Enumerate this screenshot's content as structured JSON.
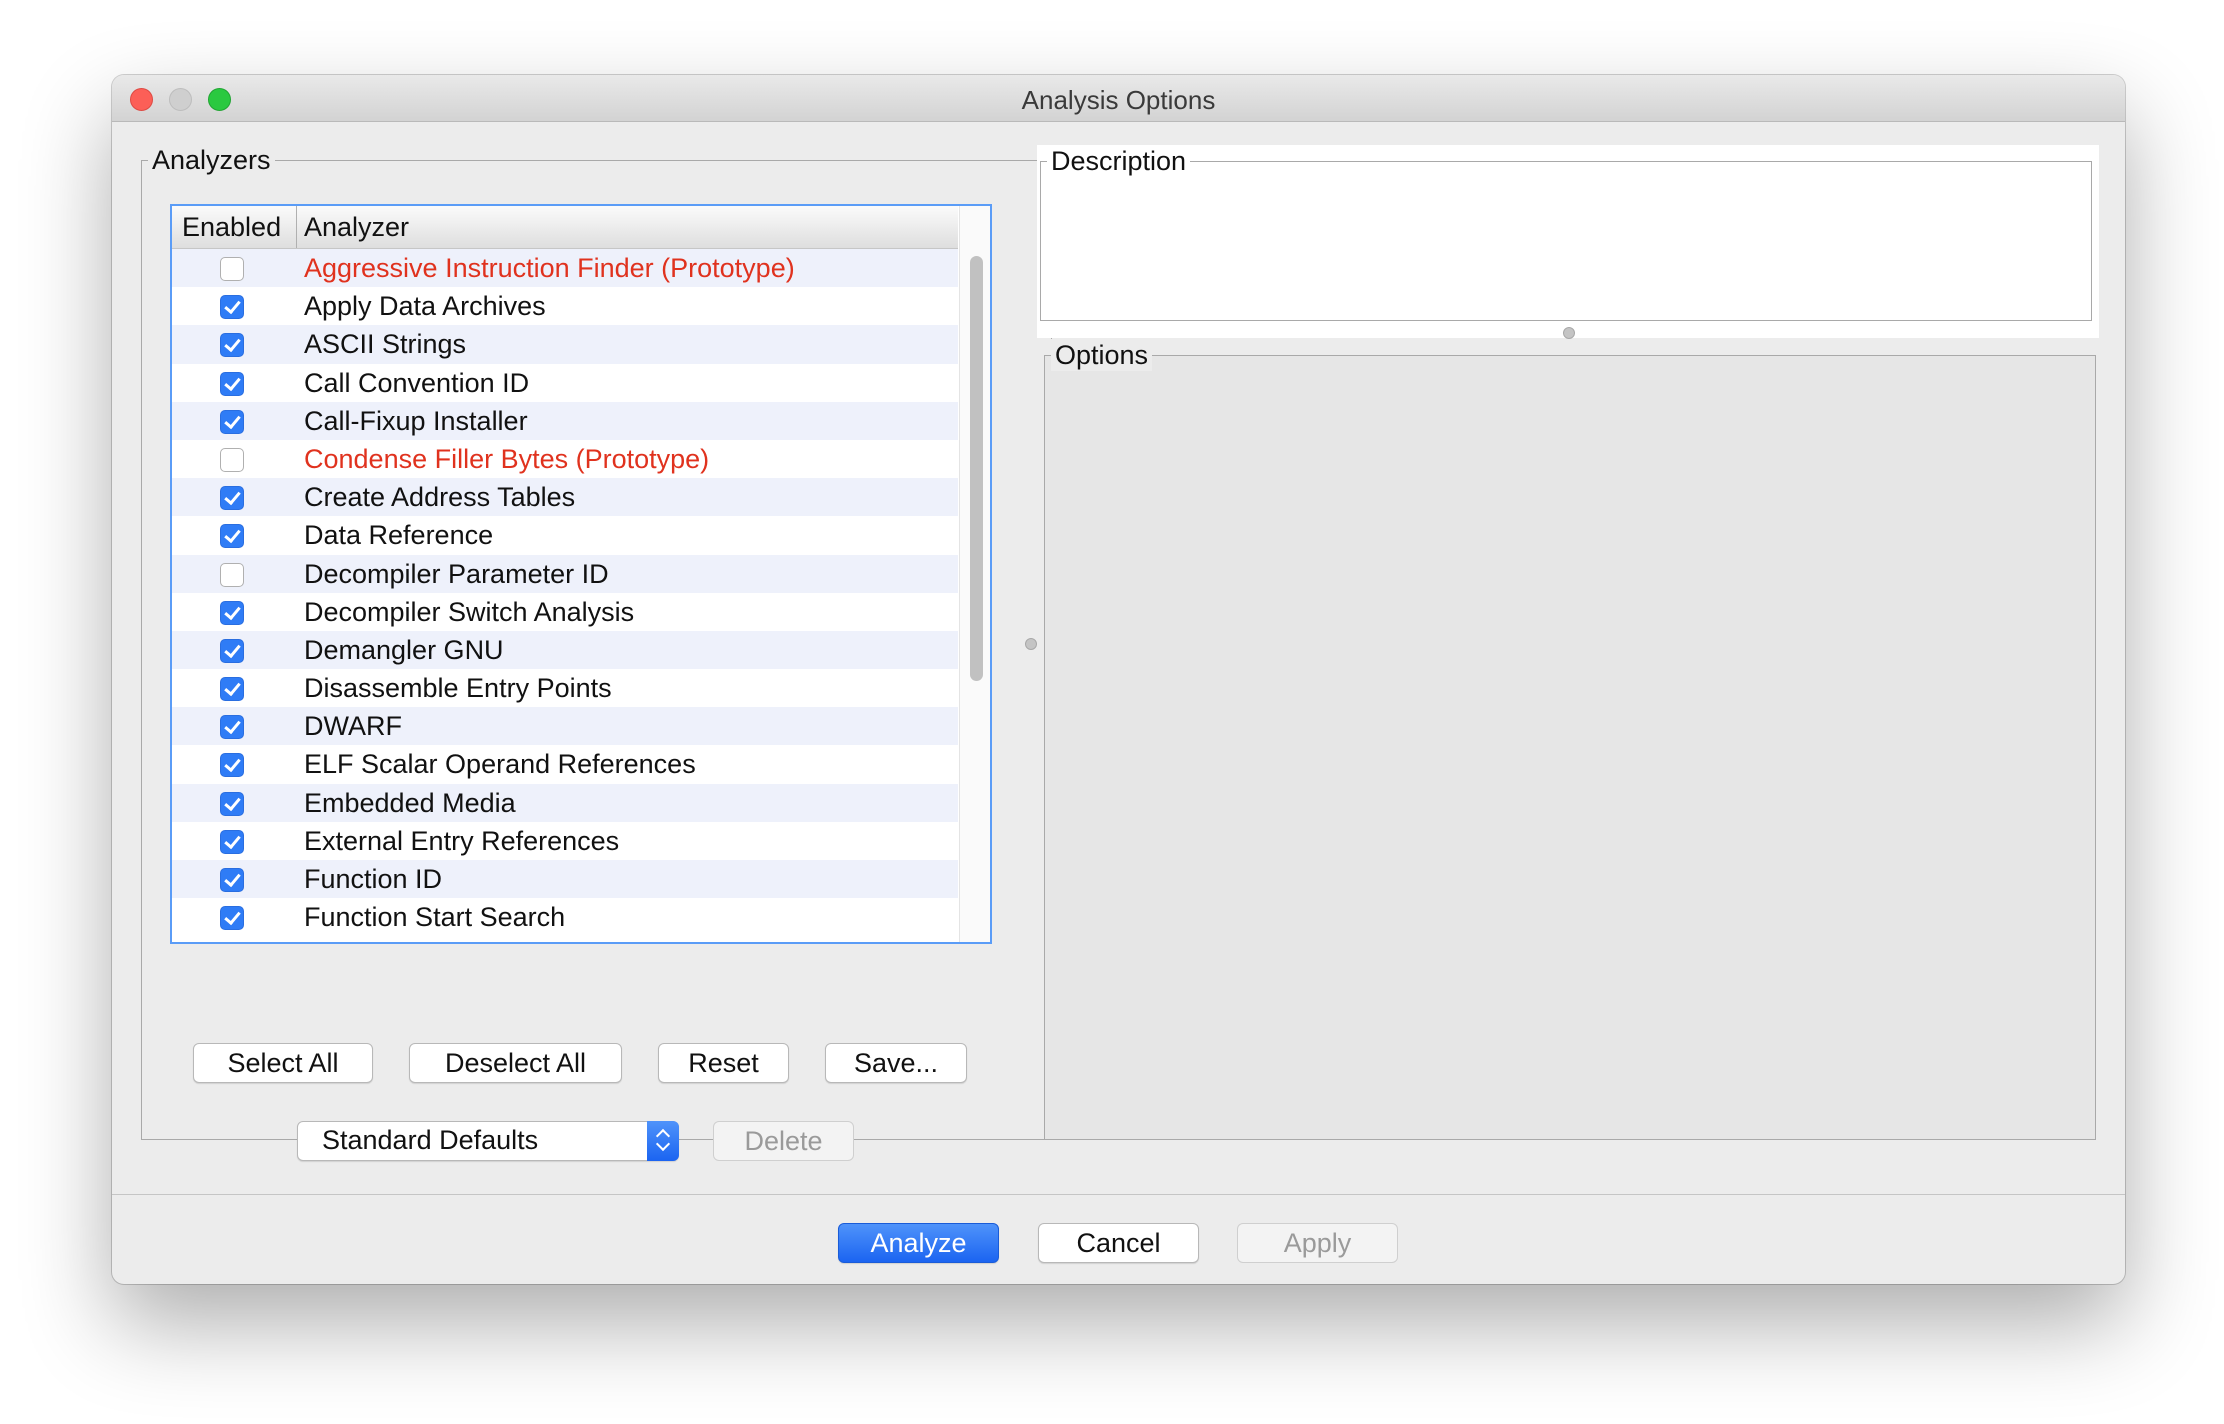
{
  "window": {
    "title": "Analysis Options"
  },
  "analyzers": {
    "legend": "Analyzers",
    "columns": {
      "enabled": "Enabled",
      "analyzer": "Analyzer"
    },
    "rows": [
      {
        "name": "Aggressive Instruction Finder (Prototype)",
        "enabled": false,
        "prototype": true
      },
      {
        "name": "Apply Data Archives",
        "enabled": true,
        "prototype": false
      },
      {
        "name": "ASCII Strings",
        "enabled": true,
        "prototype": false
      },
      {
        "name": "Call Convention ID",
        "enabled": true,
        "prototype": false
      },
      {
        "name": "Call-Fixup Installer",
        "enabled": true,
        "prototype": false
      },
      {
        "name": "Condense Filler Bytes (Prototype)",
        "enabled": false,
        "prototype": true
      },
      {
        "name": "Create Address Tables",
        "enabled": true,
        "prototype": false
      },
      {
        "name": "Data Reference",
        "enabled": true,
        "prototype": false
      },
      {
        "name": "Decompiler Parameter ID",
        "enabled": false,
        "prototype": false
      },
      {
        "name": "Decompiler Switch Analysis",
        "enabled": true,
        "prototype": false
      },
      {
        "name": "Demangler GNU",
        "enabled": true,
        "prototype": false
      },
      {
        "name": "Disassemble Entry Points",
        "enabled": true,
        "prototype": false
      },
      {
        "name": "DWARF",
        "enabled": true,
        "prototype": false
      },
      {
        "name": "ELF Scalar Operand References",
        "enabled": true,
        "prototype": false
      },
      {
        "name": "Embedded Media",
        "enabled": true,
        "prototype": false
      },
      {
        "name": "External Entry References",
        "enabled": true,
        "prototype": false
      },
      {
        "name": "Function ID",
        "enabled": true,
        "prototype": false
      },
      {
        "name": "Function Start Search",
        "enabled": true,
        "prototype": false
      }
    ],
    "buttons": {
      "select_all": "Select All",
      "deselect_all": "Deselect All",
      "reset": "Reset",
      "save": "Save..."
    },
    "profile": {
      "selected": "Standard Defaults"
    },
    "delete_label": "Delete"
  },
  "description": {
    "legend": "Description"
  },
  "options": {
    "legend": "Options"
  },
  "footer": {
    "analyze": "Analyze",
    "cancel": "Cancel",
    "apply": "Apply"
  },
  "colors": {
    "accent": "#2f7cf6",
    "prototype_text": "#e0321e",
    "selection_border": "#5a9cf7",
    "row_alt": "#eef1fb"
  }
}
